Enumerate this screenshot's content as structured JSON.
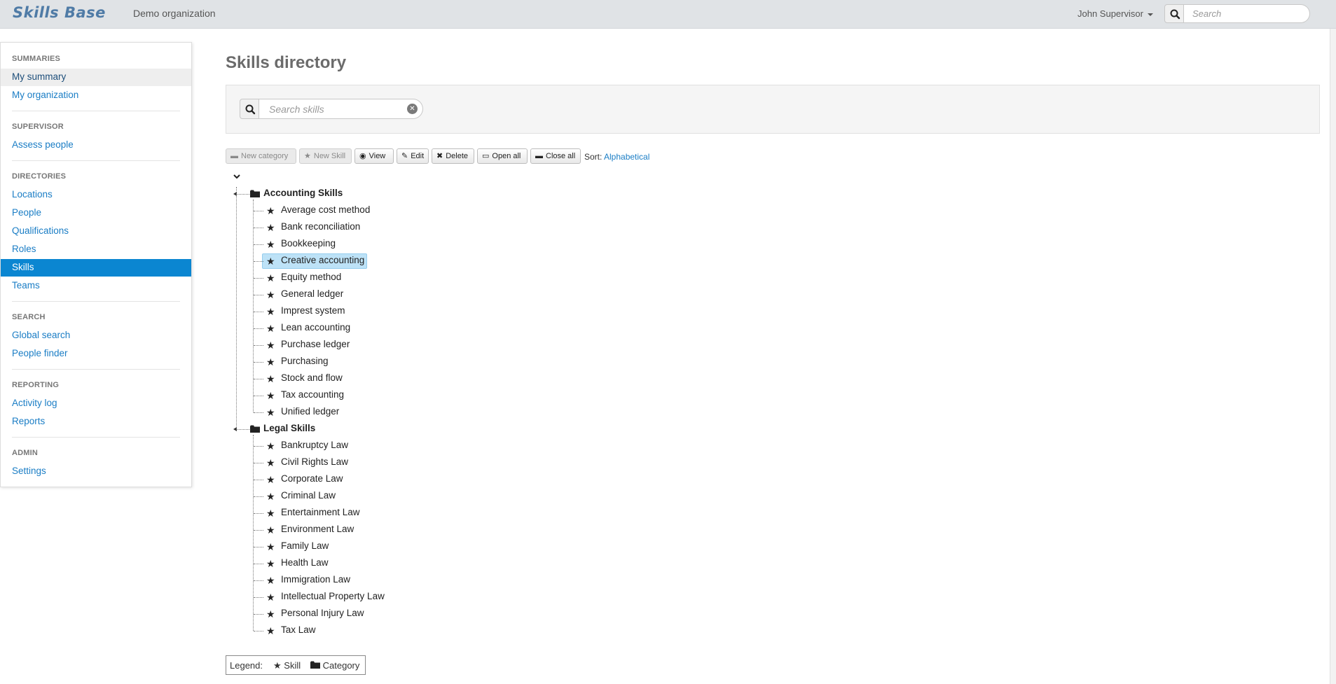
{
  "navbar": {
    "brand": "Skills Base",
    "org_name": "Demo organization",
    "user_name": "John Supervisor",
    "search_placeholder": "Search"
  },
  "sidebar": {
    "sections": [
      {
        "header": "SUMMARIES",
        "items": [
          "My summary",
          "My organization"
        ]
      },
      {
        "header": "SUPERVISOR",
        "items": [
          "Assess people"
        ]
      },
      {
        "header": "DIRECTORIES",
        "items": [
          "Locations",
          "People",
          "Qualifications",
          "Roles",
          "Skills",
          "Teams"
        ]
      },
      {
        "header": "SEARCH",
        "items": [
          "Global search",
          "People finder"
        ]
      },
      {
        "header": "REPORTING",
        "items": [
          "Activity log",
          "Reports"
        ]
      },
      {
        "header": "ADMIN",
        "items": [
          "Settings"
        ]
      }
    ],
    "hovered_item": "My summary",
    "active_item": "Skills"
  },
  "main": {
    "title": "Skills directory",
    "skill_search_placeholder": "Search skills",
    "toolbar": {
      "new_category": "New category",
      "new_skill": "New Skill",
      "view": "View",
      "edit": "Edit",
      "delete": "Delete",
      "open_all": "Open all",
      "close_all": "Close all",
      "sort_label": "Sort:",
      "sort_value": "Alphabetical"
    },
    "tree": [
      {
        "category": "Accounting Skills",
        "skills": [
          "Average cost method",
          "Bank reconciliation",
          "Bookkeeping",
          "Creative accounting",
          "Equity method",
          "General ledger",
          "Imprest system",
          "Lean accounting",
          "Purchase ledger",
          "Purchasing",
          "Stock and flow",
          "Tax accounting",
          "Unified ledger"
        ]
      },
      {
        "category": "Legal Skills",
        "skills": [
          "Bankruptcy Law",
          "Civil Rights Law",
          "Corporate Law",
          "Criminal Law",
          "Entertainment Law",
          "Environment Law",
          "Family Law",
          "Health Law",
          "Immigration Law",
          "Intellectual Property Law",
          "Personal Injury Law",
          "Tax Law"
        ]
      }
    ],
    "selected_skill": "Creative accounting",
    "legend": {
      "label": "Legend:",
      "skill": "Skill",
      "category": "Category"
    }
  },
  "colors": {
    "accent": "#0b86d1",
    "link": "#1a7dc5",
    "selection": "#bde2f7",
    "navbar_bg": "#e0e3e6"
  }
}
